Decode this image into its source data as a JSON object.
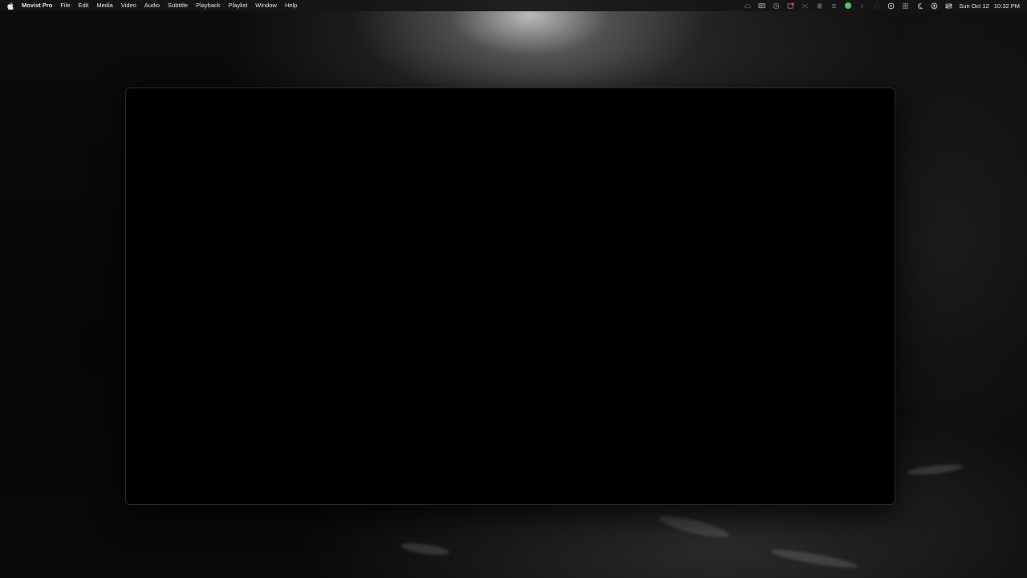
{
  "menubar": {
    "app_name": "Movist Pro",
    "menus": [
      "File",
      "Edit",
      "Media",
      "Video",
      "Audio",
      "Subtitle",
      "Playback",
      "Playlist",
      "Window",
      "Help"
    ],
    "status_icons": [
      "cloud-icon",
      "screen-icon",
      "record-icon",
      "notification-badge-icon",
      "scissors-icon",
      "clipboard-icon",
      "list-icon",
      "app-green-icon",
      "chevron-right-icon",
      "spinner-icon",
      "play-circle-icon",
      "grid-icon",
      "moon-icon",
      "user-circle-icon",
      "control-center-icon"
    ],
    "clock_date": "Sun Oct 12",
    "clock_time": "10:32 PM"
  },
  "colors": {
    "menubar_bg": "#161616",
    "menubar_text": "#e6e6e6",
    "window_bg": "#000000",
    "status_green": "#52c45a"
  }
}
